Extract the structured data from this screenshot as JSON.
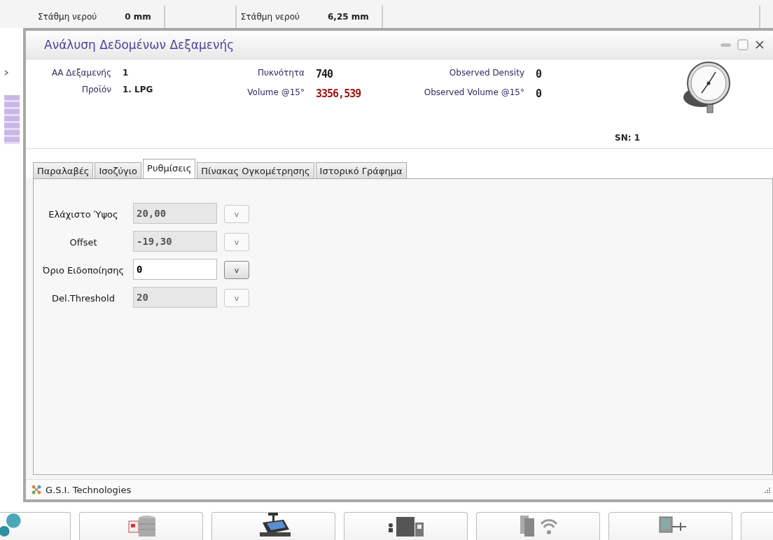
{
  "background": {
    "top_cells": [
      {
        "label": "Στάθμη νερού",
        "value": "0 mm"
      },
      {
        "label": "Στάθμη νερού",
        "value": "6,25 mm"
      }
    ]
  },
  "window": {
    "title": "Ανάλυση Δεδομένων Δεξαμενής"
  },
  "info": {
    "columns": [
      [
        {
          "label": "ΑΑ Δεξαμενής",
          "value": "1",
          "kind": "text"
        },
        {
          "label": "Προϊόν",
          "value": "1. LPG",
          "kind": "text"
        }
      ],
      [
        {
          "label": "Πυκνότητα",
          "value": "740",
          "kind": "digital"
        },
        {
          "label": "Volume @15°",
          "value": "3356,539",
          "kind": "alert"
        }
      ],
      [
        {
          "label": "Observed Density",
          "value": "0",
          "kind": "digital"
        },
        {
          "label": "Observed Volume @15°",
          "value": "0",
          "kind": "digital"
        }
      ]
    ],
    "serial": "SN: 1"
  },
  "tabs": [
    {
      "label": "Παραλαβές",
      "selected": false
    },
    {
      "label": "Ισοζύγιο",
      "selected": false
    },
    {
      "label": "Ρυθμίσεις",
      "selected": true
    },
    {
      "label": "Πίνακας Ογκομέτρησης",
      "selected": false
    },
    {
      "label": "Ιστορικό Γράφημα",
      "selected": false
    }
  ],
  "settings": [
    {
      "label": "Ελάχιστο Ύψος",
      "value": "20,00",
      "disabled": true,
      "button": "v"
    },
    {
      "label": "Offset",
      "value": "-19,30",
      "disabled": true,
      "button": "v"
    },
    {
      "label": "Όριο Ειδοποίησης",
      "value": "0",
      "disabled": false,
      "button": "v"
    },
    {
      "label": "Del.Threshold",
      "value": "20",
      "disabled": true,
      "button": "v"
    }
  ],
  "status_bar": {
    "text": "G.S.I. Technologies"
  }
}
